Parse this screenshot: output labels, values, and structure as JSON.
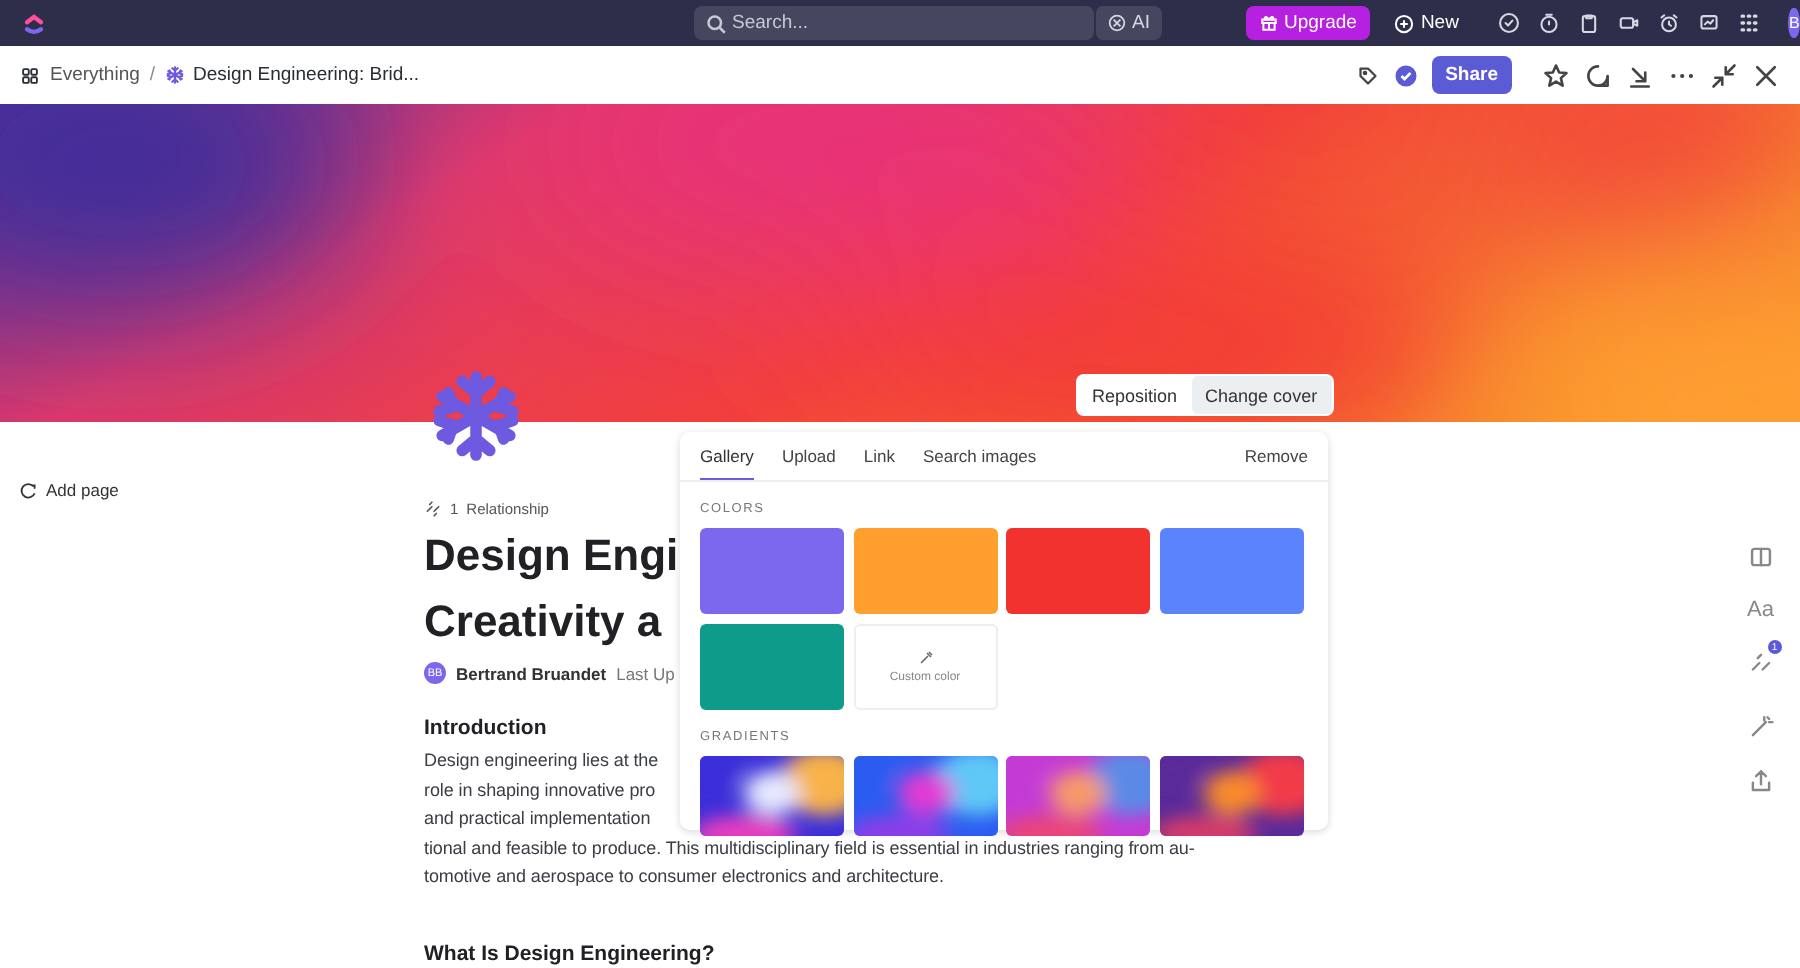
{
  "top_bar": {
    "search": {
      "placeholder": "Search..."
    },
    "ai_button": "AI",
    "upgrade_button": "Upgrade",
    "new_button": "New",
    "avatar": "B"
  },
  "breadcrumb": {
    "items": [
      {
        "label": "Everything"
      },
      {
        "label": "Design Engineering: Brid..."
      }
    ],
    "separator": "/",
    "share_button": "Share"
  },
  "cover": {
    "buttons": [
      {
        "label": "Reposition",
        "selected": false
      },
      {
        "label": "Change cover",
        "selected": true
      }
    ]
  },
  "cover_popover": {
    "tabs": [
      {
        "label": "Gallery",
        "selected": true
      },
      {
        "label": "Upload",
        "selected": false
      },
      {
        "label": "Link",
        "selected": false
      },
      {
        "label": "Search images",
        "selected": false
      }
    ],
    "remove": "Remove",
    "colors_heading": "COLORS",
    "colors": [
      {
        "color": "#7b68ee"
      },
      {
        "color": "#ff9f2d"
      },
      {
        "color": "#f2322e"
      },
      {
        "color": "#5b83fb"
      },
      {
        "color": "#0e9b8a"
      }
    ],
    "custom_color": "Custom color",
    "gradients_heading": "GRADIENTS"
  },
  "sidebar": {
    "add_page": "Add page"
  },
  "document": {
    "relationship_count": "1",
    "relationship_label": "Relationship",
    "title_lines": [
      "Design Engi",
      "Creativity a"
    ],
    "author_initials": "BB",
    "author": "Bertrand Bruandet",
    "last_updated": "Last Up",
    "intro_heading": "Introduction",
    "intro_lines": [
      "Design engineering lies at the",
      "role in shaping innovative pro",
      "and practical implementation",
      "tional and feasible to produce. This multidisciplinary field is essential in industries ranging from au-",
      "tomotive and aerospace to consumer electronics and architecture."
    ],
    "next_heading": "What Is Design Engineering?"
  },
  "right_toolbar": {
    "font_button": "Aa",
    "badge": "1"
  }
}
